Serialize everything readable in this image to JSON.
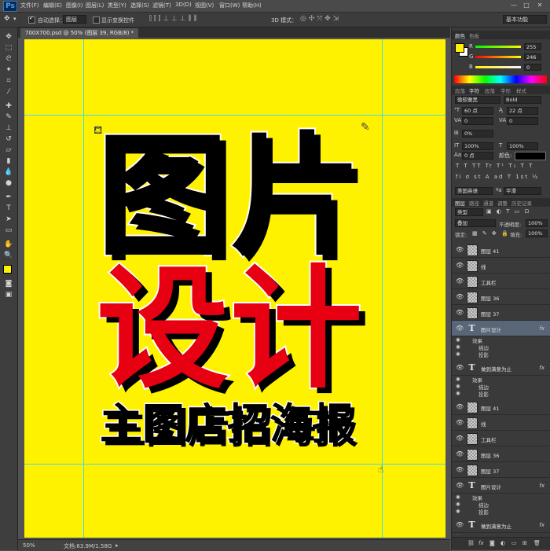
{
  "menubar": {
    "app_logo": "Ps",
    "items": [
      "文件(F)",
      "编辑(E)",
      "图像(I)",
      "图层(L)",
      "类型(Y)",
      "选择(S)",
      "滤镜(T)",
      "3D(D)",
      "视图(V)",
      "窗口(W)",
      "帮助(H)"
    ],
    "window_controls": [
      "—",
      "□",
      "✕"
    ]
  },
  "options_bar": {
    "auto_select_label": "自动选择：",
    "auto_select_value": "图层",
    "show_transform_label": "显示变换控件",
    "mode_3d_label": "3D 模式：",
    "workspace": "基本功能"
  },
  "document": {
    "tab_title": "700X700.psd @ 50% (图层 39, RGB/8) *",
    "canvas_color": "#fff200",
    "headline_chars": [
      "图",
      "片"
    ],
    "accent_chars": [
      "设",
      "计"
    ],
    "subtitle": "主图店招海报",
    "headline_color": "#000000",
    "accent_color": "#e60012"
  },
  "status_bar": {
    "zoom": "50%",
    "doc_info": "文档:63.9M/1.58G"
  },
  "color_panel": {
    "tabs": [
      "颜色",
      "色板"
    ],
    "r_label": "R",
    "r_value": "255",
    "g_label": "G",
    "g_value": "246",
    "b_label": "B",
    "b_value": "0",
    "foreground": "#fff200",
    "background": "#ffffff"
  },
  "character_panel": {
    "tabs": [
      "段落",
      "字符",
      "段落",
      "字形",
      "样式"
    ],
    "font_family": "微软雅黑",
    "font_style": "Bold",
    "font_size": "60 点",
    "leading": "22 点",
    "kerning": "0",
    "tracking": "0",
    "scale_pct": "0%",
    "vertical_scale": "100%",
    "horizontal_scale": "100%",
    "baseline": "0 点",
    "color_label": "颜色:",
    "language": "美国英语",
    "anti_alias": "平滑"
  },
  "layers_panel": {
    "tabs": [
      "图层",
      "路径",
      "通道",
      "调整",
      "历史记录"
    ],
    "filter": "类型",
    "blend_mode": "叠加",
    "opacity_label": "不透明度:",
    "opacity": "100%",
    "lock_label": "锁定:",
    "fill_label": "填充:",
    "fill": "100%",
    "effects_label": "效果",
    "stroke_label": "描边",
    "shadow_label": "投影",
    "layers": [
      {
        "name": "图层 41",
        "type": "pixel"
      },
      {
        "name": "线",
        "type": "pixel"
      },
      {
        "name": "工具栏",
        "type": "pixel"
      },
      {
        "name": "图层 36",
        "type": "pixel"
      },
      {
        "name": "图层 37",
        "type": "pixel"
      },
      {
        "name": "图片设计",
        "type": "text",
        "selected": true
      },
      {
        "name": "做到满意为止",
        "type": "text"
      },
      {
        "name": "图层 41",
        "type": "pixel"
      },
      {
        "name": "线",
        "type": "pixel"
      },
      {
        "name": "工具栏",
        "type": "pixel"
      },
      {
        "name": "图层 36",
        "type": "pixel"
      },
      {
        "name": "图层 37",
        "type": "pixel"
      },
      {
        "name": "图片设计",
        "type": "text"
      },
      {
        "name": "做到满意为止",
        "type": "text"
      }
    ],
    "bottom_icons": [
      "link-icon",
      "fx-icon",
      "mask-icon",
      "adjustment-icon",
      "folder-icon",
      "new-layer-icon",
      "trash-icon"
    ]
  }
}
